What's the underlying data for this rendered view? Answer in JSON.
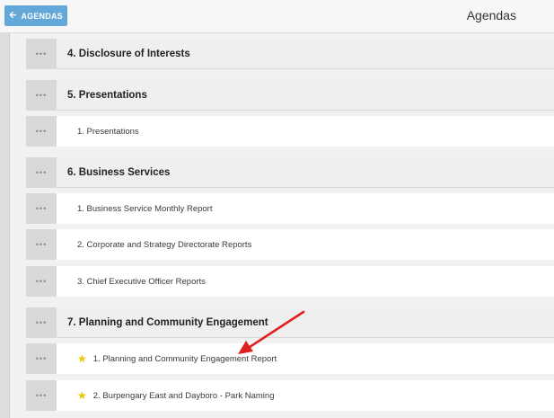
{
  "header": {
    "back_label": "AGENDAS",
    "title": "Agendas"
  },
  "agenda": {
    "handle_glyph": "•••",
    "rows": [
      {
        "kind": "section",
        "label": "4. Disclosure of Interests"
      },
      {
        "kind": "section",
        "label": "5. Presentations"
      },
      {
        "kind": "item",
        "label": "1. Presentations"
      },
      {
        "kind": "section",
        "label": "6. Business Services"
      },
      {
        "kind": "item",
        "label": "1. Business Service Monthly Report"
      },
      {
        "kind": "item",
        "label": "2. Corporate and Strategy Directorate Reports"
      },
      {
        "kind": "item",
        "label": "3. Chief Executive Officer Reports"
      },
      {
        "kind": "section",
        "label": "7. Planning and Community Engagement"
      },
      {
        "kind": "item",
        "label": "1. Planning and Community Engagement Report",
        "starred": true
      },
      {
        "kind": "item",
        "label": "2. Burpengary East and Dayboro - Park Naming",
        "starred": true
      }
    ]
  },
  "colors": {
    "accent": "#63a8d8",
    "annotation_arrow": "#e02020",
    "star": "#f0c400"
  },
  "icons": {
    "back": "arrow-left-icon",
    "handle": "drag-handle-icon",
    "star": "star-icon"
  }
}
